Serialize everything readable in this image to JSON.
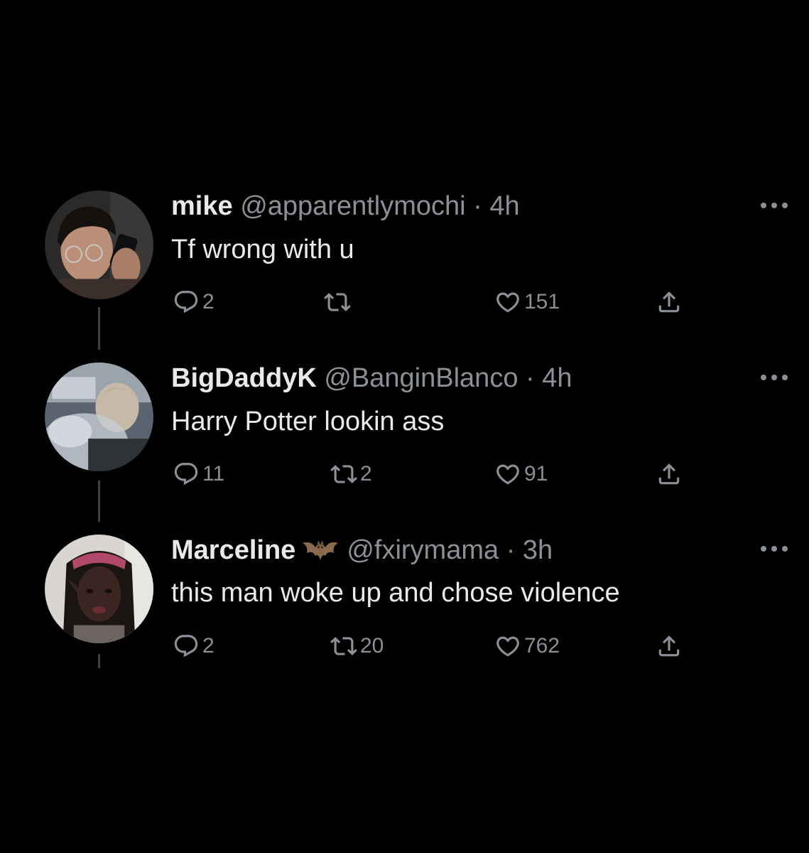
{
  "tweets": [
    {
      "name": "mike",
      "handle": "@apparentlymochi",
      "separator": "·",
      "time": "4h",
      "text": "Tf wrong with u",
      "replies": "2",
      "retweets": "",
      "likes": "151"
    },
    {
      "name": "BigDaddyK",
      "handle": "@BanginBlanco",
      "separator": "·",
      "time": "4h",
      "text": "Harry Potter lookin ass",
      "replies": "11",
      "retweets": "2",
      "likes": "91"
    },
    {
      "name": "Marceline",
      "badge": "bat-emoji",
      "handle": "@fxirymama",
      "separator": "·",
      "time": "3h",
      "text": "this man woke up and chose violence",
      "replies": "2",
      "retweets": "20",
      "likes": "762"
    }
  ],
  "icons": {
    "reply": "reply-icon",
    "retweet": "retweet-icon",
    "like": "heart-icon",
    "share": "share-icon",
    "more": "more-options-icon"
  },
  "colors": {
    "background": "#000000",
    "primary_text": "#e7e9ea",
    "secondary_text": "#8b9096",
    "thread_line": "#3d4146"
  }
}
